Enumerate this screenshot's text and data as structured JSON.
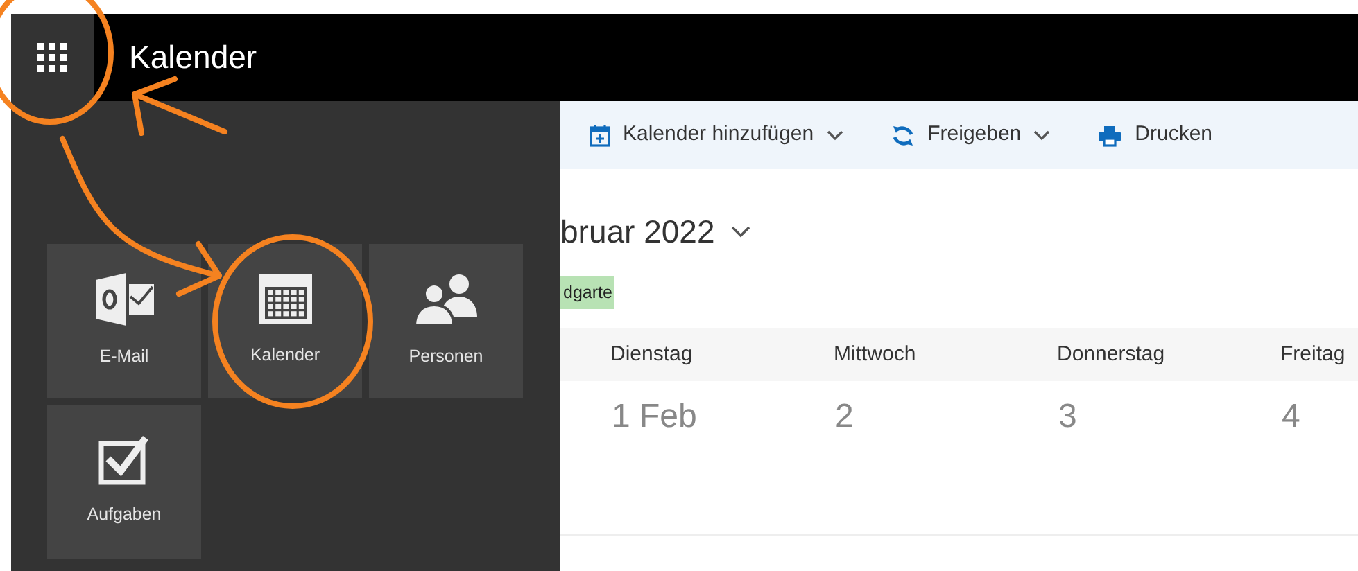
{
  "header": {
    "title": "Kalender"
  },
  "app_tiles": [
    {
      "kind": "mail",
      "label": "E-Mail"
    },
    {
      "kind": "calendar",
      "label": "Kalender"
    },
    {
      "kind": "people",
      "label": "Personen"
    },
    {
      "kind": "tasks",
      "label": "Aufgaben"
    }
  ],
  "toolbar": [
    {
      "kind": "add-calendar",
      "label": "Kalender hinzufügen",
      "dropdown": true
    },
    {
      "kind": "share",
      "label": "Freigeben",
      "dropdown": true
    },
    {
      "kind": "print",
      "label": "Drucken",
      "dropdown": false
    }
  ],
  "month_title": "bruar 2022",
  "calendar_tag": {
    "label": "dgarte",
    "color": "#b8e2b4"
  },
  "weekdays": [
    "Dienstag",
    "Mittwoch",
    "Donnerstag",
    "Freitag"
  ],
  "dates": [
    "1 Feb",
    "2",
    "3",
    "4"
  ],
  "annotations": [
    {
      "kind": "circle"
    },
    {
      "kind": "arrow"
    },
    {
      "kind": "arrow"
    },
    {
      "kind": "circle"
    }
  ]
}
